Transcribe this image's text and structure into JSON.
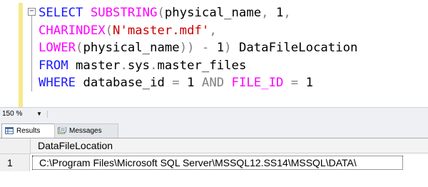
{
  "editor": {
    "collapse_symbol": "−",
    "lines": [
      {
        "tokens": [
          {
            "t": "SELECT ",
            "c": "kw"
          },
          {
            "t": "SUBSTRING",
            "c": "fn"
          },
          {
            "t": "(",
            "c": "gray"
          },
          {
            "t": "physical_name",
            "c": "plain"
          },
          {
            "t": ", ",
            "c": "gray"
          },
          {
            "t": "1",
            "c": "plain"
          },
          {
            "t": ",",
            "c": "gray"
          }
        ]
      },
      {
        "tokens": [
          {
            "t": "CHARINDEX",
            "c": "fn"
          },
          {
            "t": "(",
            "c": "gray"
          },
          {
            "t": "N'master.mdf'",
            "c": "str"
          },
          {
            "t": ",",
            "c": "gray"
          }
        ]
      },
      {
        "tokens": [
          {
            "t": "LOWER",
            "c": "fn"
          },
          {
            "t": "(",
            "c": "gray"
          },
          {
            "t": "physical_name",
            "c": "plain"
          },
          {
            "t": ")) ",
            "c": "gray"
          },
          {
            "t": "- ",
            "c": "gray"
          },
          {
            "t": "1",
            "c": "plain"
          },
          {
            "t": ") ",
            "c": "gray"
          },
          {
            "t": "DataFileLocation",
            "c": "plain"
          }
        ]
      },
      {
        "tokens": [
          {
            "t": "FROM ",
            "c": "kw"
          },
          {
            "t": "master",
            "c": "plain"
          },
          {
            "t": ".",
            "c": "gray"
          },
          {
            "t": "sys",
            "c": "plain"
          },
          {
            "t": ".",
            "c": "gray"
          },
          {
            "t": "master_files",
            "c": "plain"
          }
        ]
      },
      {
        "tokens": [
          {
            "t": "WHERE ",
            "c": "kw"
          },
          {
            "t": "database_id ",
            "c": "plain"
          },
          {
            "t": "= ",
            "c": "gray"
          },
          {
            "t": "1 ",
            "c": "plain"
          },
          {
            "t": "AND ",
            "c": "gray"
          },
          {
            "t": "FILE_ID",
            "c": "fn"
          },
          {
            "t": " ",
            "c": "plain"
          },
          {
            "t": "= ",
            "c": "gray"
          },
          {
            "t": "1",
            "c": "plain"
          }
        ]
      }
    ]
  },
  "zoom": {
    "value": "150 %"
  },
  "tabs": {
    "results": "Results",
    "messages": "Messages"
  },
  "grid": {
    "columns": [
      "DataFileLocation"
    ],
    "rows": [
      {
        "num": "1",
        "cells": [
          "C:\\Program Files\\Microsoft SQL Server\\MSSQL12.SS14\\MSSQL\\DATA\\"
        ]
      }
    ]
  },
  "colors": {
    "keyword": "#1a1aff",
    "function": "#ff00ff",
    "string": "#cc0000",
    "operator": "#808080",
    "change_marker": "#f5e98a"
  },
  "icons": {
    "results_tab": "grid-icon",
    "messages_tab": "messages-icon",
    "zoom_dropdown": "chevron-down-icon"
  }
}
